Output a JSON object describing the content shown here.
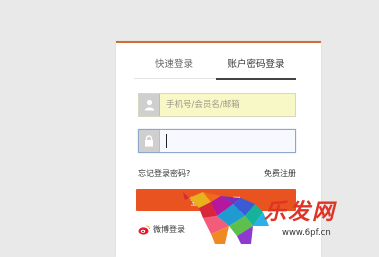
{
  "tabs": {
    "quick": "快速登录",
    "account": "账户密码登录"
  },
  "username": {
    "placeholder": "手机号/会员名/邮箱",
    "icon": "user-icon"
  },
  "password": {
    "icon": "lock-icon"
  },
  "links": {
    "forgot": "忘记登录密码?",
    "register": "免费注册"
  },
  "login_button": "登 录",
  "social": {
    "weibo": "微博登录"
  },
  "watermark": {
    "brand": "乐发网",
    "url": "www.6pf.cn"
  },
  "colors": {
    "accent": "#e8531f",
    "field_highlight": "#f8f7c6"
  }
}
